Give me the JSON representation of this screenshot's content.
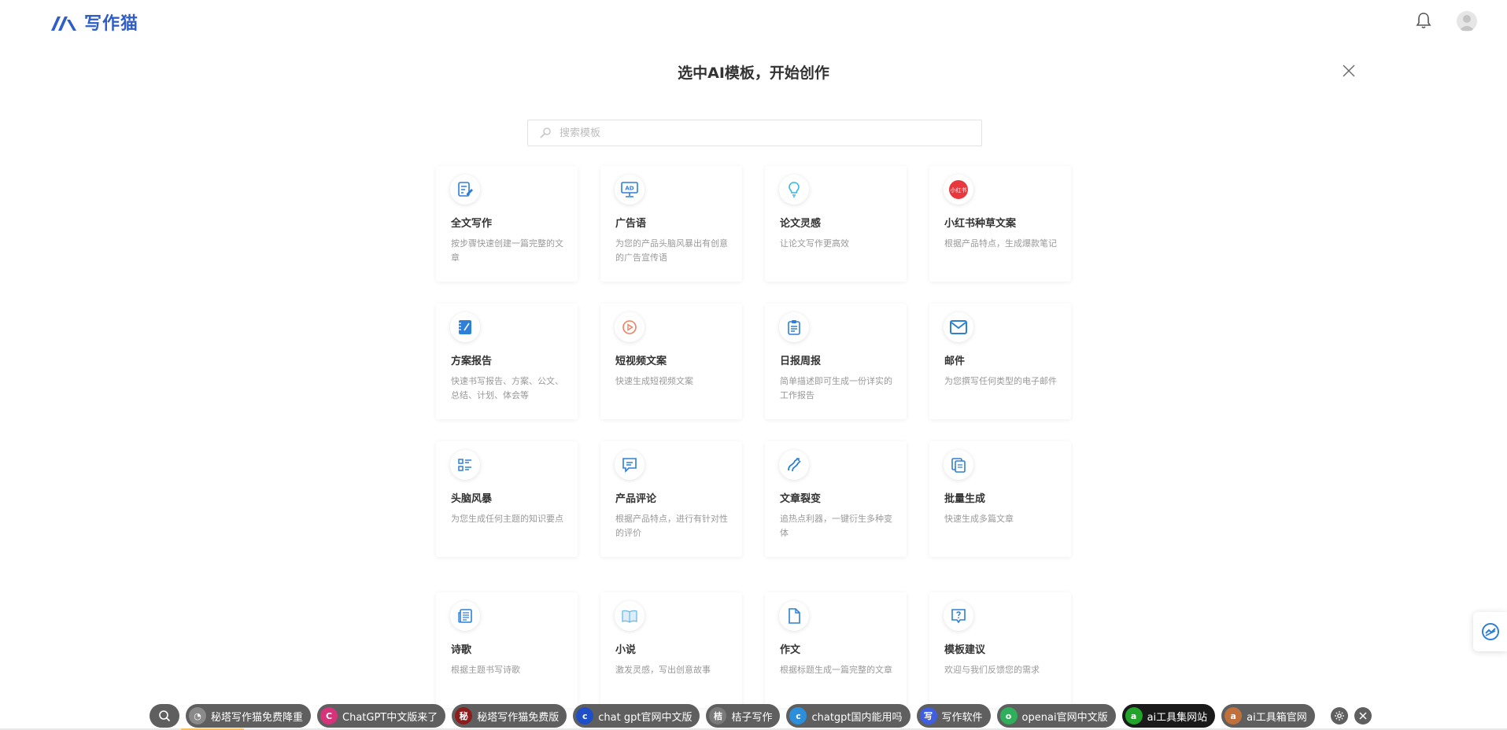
{
  "header": {
    "logo_text": "写作猫",
    "brand_color": "#2f5ec8"
  },
  "modal": {
    "title": "选中AI模板，开始创作",
    "search_placeholder": "搜索模板"
  },
  "cards": [
    {
      "title": "全文写作",
      "desc": "按步骤快速创建一篇完整的文章",
      "icon": "doc-edit-icon"
    },
    {
      "title": "广告语",
      "desc": "为您的产品头脑风暴出有创意的广告宣传语",
      "icon": "ad-board-icon"
    },
    {
      "title": "论文灵感",
      "desc": "让论文写作更高效",
      "icon": "lightbulb-icon"
    },
    {
      "title": "小红书种草文案",
      "desc": "根据产品特点，生成爆款笔记",
      "icon": "xiaohongshu-icon",
      "icon_text": "小红书"
    },
    {
      "title": "方案报告",
      "desc": "快速书写报告、方案、公文、总结、计划、体会等",
      "icon": "notebook-icon"
    },
    {
      "title": "短视频文案",
      "desc": "快速生成短视频文案",
      "icon": "play-icon"
    },
    {
      "title": "日报周报",
      "desc": "简单描述即可生成一份详实的工作报告",
      "icon": "clipboard-icon"
    },
    {
      "title": "邮件",
      "desc": "为您撰写任何类型的电子邮件",
      "icon": "mail-icon"
    },
    {
      "title": "头脑风暴",
      "desc": "为您生成任何主题的知识要点",
      "icon": "list-icon"
    },
    {
      "title": "产品评论",
      "desc": "根据产品特点，进行有针对性的评价",
      "icon": "comment-icon"
    },
    {
      "title": "文章裂变",
      "desc": "追热点利器，一键衍生多种变体",
      "icon": "split-icon"
    },
    {
      "title": "批量生成",
      "desc": "快速生成多篇文章",
      "icon": "copies-icon"
    },
    {
      "title": "诗歌",
      "desc": "根据主题书写诗歌",
      "icon": "newspaper-icon"
    },
    {
      "title": "小说",
      "desc": "激发灵感，写出创意故事",
      "icon": "book-icon"
    },
    {
      "title": "作文",
      "desc": "根据标题生成一篇完整的文章",
      "icon": "file-icon"
    },
    {
      "title": "模板建议",
      "desc": "欢迎与我们反馈您的需求",
      "icon": "question-bubble-icon"
    }
  ],
  "bottom_bar": {
    "items": [
      {
        "label": "秘塔写作猫免费降重",
        "badge": "◔",
        "badge_color": "#8a8a8a"
      },
      {
        "label": "ChatGPT中文版来了",
        "badge": "C",
        "badge_color": "#d6337a"
      },
      {
        "label": "秘塔写作猫免费版",
        "badge": "秘",
        "badge_color": "#8b1d1d"
      },
      {
        "label": "chat gpt官网中文版",
        "badge": "c",
        "badge_color": "#1f4fc7"
      },
      {
        "label": "桔子写作",
        "badge": "桔",
        "badge_color": "#7a7a7a"
      },
      {
        "label": "chatgpt国内能用吗",
        "badge": "c",
        "badge_color": "#2b8fdc"
      },
      {
        "label": "写作软件",
        "badge": "写",
        "badge_color": "#3f5fe0"
      },
      {
        "label": "openai官网中文版",
        "badge": "o",
        "badge_color": "#2fae5c"
      },
      {
        "label": "ai工具集网站",
        "badge": "a",
        "badge_color": "#22a32a",
        "dark": true
      },
      {
        "label": "ai工具箱官网",
        "badge": "a",
        "badge_color": "#c0703a"
      }
    ]
  }
}
